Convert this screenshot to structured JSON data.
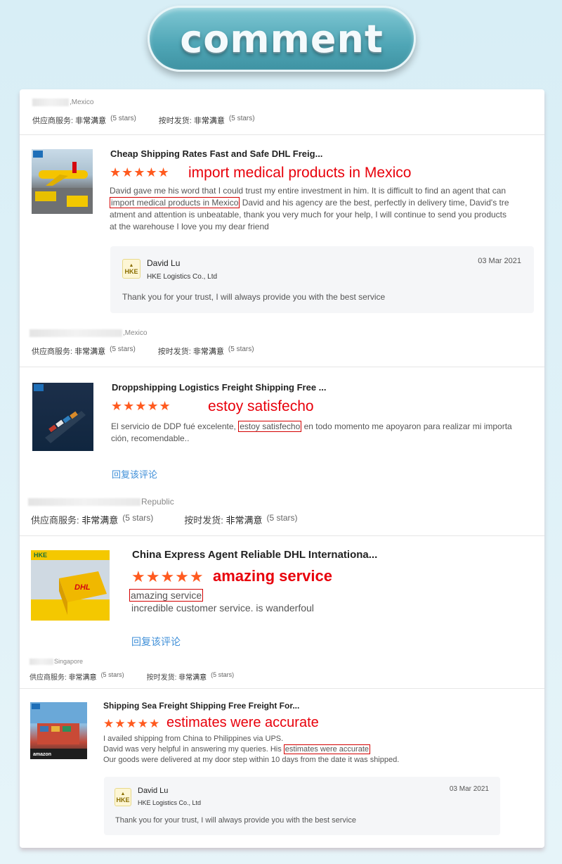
{
  "header": {
    "title": "comment"
  },
  "reviews": [
    {
      "location": ",Mexico",
      "supplier_service_label": "供应商服务:",
      "supplier_service_value": "非常满意",
      "supplier_service_stars": "(5 stars)",
      "ontime_label": "按时发货:",
      "ontime_value": "非常满意",
      "ontime_stars": "(5 stars)",
      "product_title": "Cheap Shipping Rates Fast and Safe DHL Freig...",
      "stars": "★★★★★",
      "highlight_note": "import medical products in Mexico",
      "body_pre": "David gave me his word that I could trust my entire investment in him. It is difficult to find an agent that can ",
      "body_boxed": "import medical products in Mexico",
      "body_post": " David and his agency are the best, perfectly in delivery time, David's tre atment and attention is unbeatable, thank you very much for your help, I will continue to send you products at the warehouse I love you my dear friend",
      "reply": {
        "name": "David Lu",
        "company": "HKE Logistics Co., Ltd",
        "date": "03 Mar 2021",
        "text": "Thank you for your trust, I will always provide you with the best service"
      }
    },
    {
      "location": ",Mexico",
      "supplier_service_label": "供应商服务:",
      "supplier_service_value": "非常满意",
      "supplier_service_stars": "(5 stars)",
      "ontime_label": "按时发货:",
      "ontime_value": "非常满意",
      "ontime_stars": "(5 stars)",
      "product_title": "Droppshipping Logistics Freight Shipping Free ...",
      "stars": "★★★★★",
      "highlight_note": "estoy satisfecho",
      "body_pre": "El servicio de DDP fué excelente, ",
      "body_boxed": "estoy satisfecho",
      "body_post": " en todo momento me apoyaron para realizar mi importa ción, recomendable..",
      "reply_link": "回复该评论"
    },
    {
      "location": "Republic",
      "supplier_service_label": "供应商服务:",
      "supplier_service_value": "非常满意",
      "supplier_service_stars": "(5 stars)",
      "ontime_label": "按时发货:",
      "ontime_value": "非常满意",
      "ontime_stars": "(5 stars)",
      "product_title": "China Express Agent Reliable DHL Internationa...",
      "stars": "★★★★★",
      "highlight_note": "amazing service",
      "body_boxed": "amazing service",
      "body_line2": "incredible customer service. is wanderfoul",
      "reply_link": "回复该评论",
      "thumb_brand": "HKE",
      "thumb_dhl": "DHL"
    },
    {
      "location": "Singapore",
      "supplier_service_label": "供应商服务:",
      "supplier_service_value": "非常满意",
      "supplier_service_stars": "(5 stars)",
      "ontime_label": "按时发货:",
      "ontime_value": "非常满意",
      "ontime_stars": "(5 stars)",
      "product_title": "Shipping Sea Freight Shipping Free Freight For...",
      "stars": "★★★★★",
      "highlight_note": "estimates were accurate",
      "body_line1": "I availed shipping from China to Philippines via UPS.",
      "body_pre": "David was very helpful in answering my queries. His ",
      "body_boxed": "estimates were accurate",
      "body_line3": "Our goods were delivered at my door step within 10 days from the date it was shipped.",
      "thumb_brand": "amazon",
      "reply": {
        "name": "David Lu",
        "company": "HKE Logistics Co., Ltd",
        "date": "03 Mar 2021",
        "text": "Thank you for your trust, I will always provide you with the best service"
      }
    }
  ],
  "logo_text": "HKE",
  "colors": {
    "accent_orange": "#ff5a1f",
    "note_red": "#e8000b",
    "link_blue": "#3f8fd8"
  }
}
